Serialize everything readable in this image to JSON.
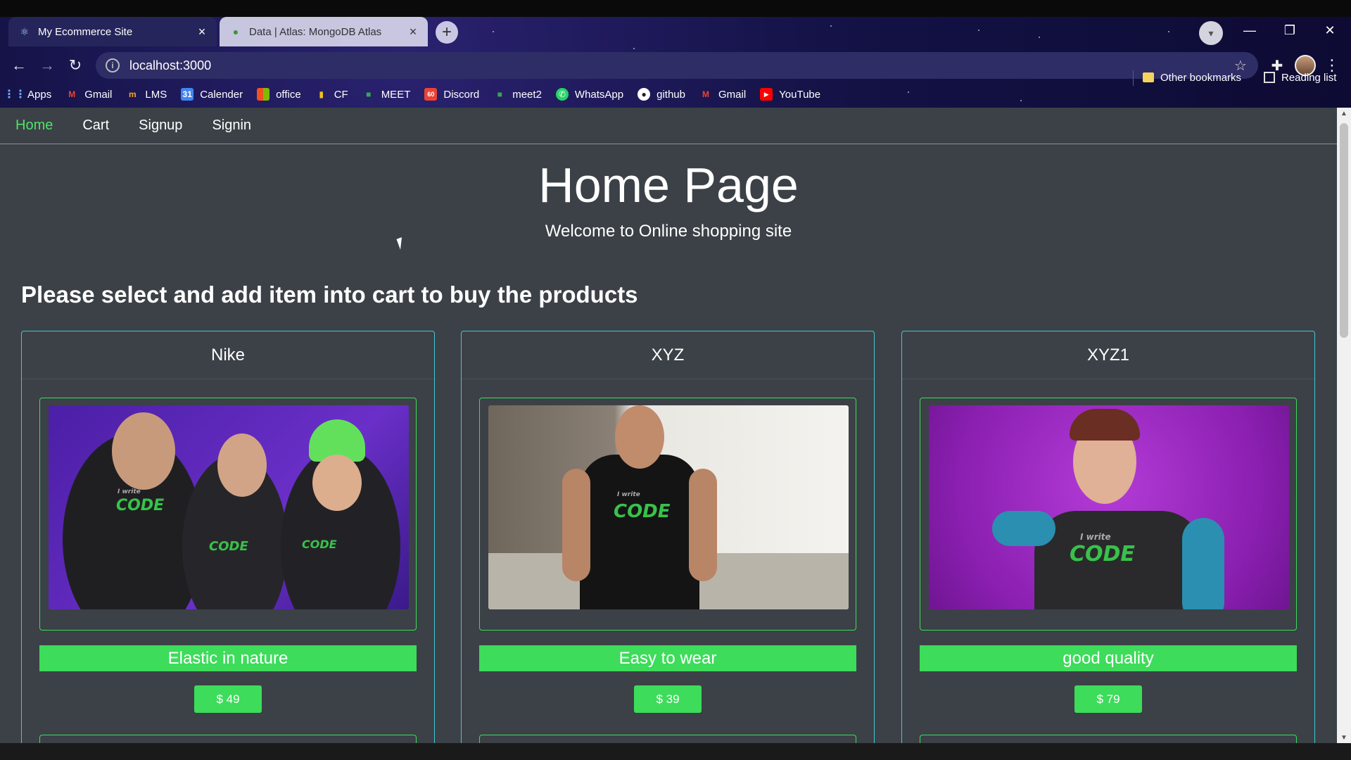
{
  "browser": {
    "tabs": [
      {
        "title": "My Ecommerce Site",
        "active": true
      },
      {
        "title": "Data | Atlas: MongoDB Atlas",
        "active": false
      }
    ],
    "address": "localhost:3000",
    "bookmarks": [
      {
        "label": "Apps",
        "icon": "apps-grid-icon"
      },
      {
        "label": "Gmail",
        "icon": "gmail-icon"
      },
      {
        "label": "LMS",
        "icon": "lms-icon"
      },
      {
        "label": "Calender",
        "icon": "calendar-icon"
      },
      {
        "label": "office",
        "icon": "office-icon"
      },
      {
        "label": "CF",
        "icon": "codeforces-icon"
      },
      {
        "label": "MEET",
        "icon": "meet-icon"
      },
      {
        "label": "Discord",
        "icon": "discord-icon"
      },
      {
        "label": "meet2",
        "icon": "meet-icon"
      },
      {
        "label": "WhatsApp",
        "icon": "whatsapp-icon"
      },
      {
        "label": "github",
        "icon": "github-icon"
      },
      {
        "label": "Gmail",
        "icon": "gmail-icon"
      },
      {
        "label": "YouTube",
        "icon": "youtube-icon"
      }
    ],
    "other_bookmarks": "Other bookmarks",
    "reading_list": "Reading list"
  },
  "site": {
    "nav": [
      {
        "label": "Home",
        "active": true
      },
      {
        "label": "Cart",
        "active": false
      },
      {
        "label": "Signup",
        "active": false
      },
      {
        "label": "Signin",
        "active": false
      }
    ],
    "hero_title": "Home Page",
    "hero_subtitle": "Welcome to Online shopping site",
    "section_title": "Please select and add item into cart to buy the products",
    "products": [
      {
        "name": "Nike",
        "description": "Elastic in nature",
        "price": "$ 49",
        "image": "three people in black I write CODE hoodies"
      },
      {
        "name": "XYZ",
        "description": "Easy to wear",
        "price": "$ 39",
        "image": "man in black I write CODE t-shirt"
      },
      {
        "name": "XYZ1",
        "description": "good quality",
        "price": "$ 79",
        "image": "woman in raglan I write CODE shirt on purple"
      }
    ],
    "image_text_top": "I write",
    "image_text_code": "CODE"
  },
  "colors": {
    "page_bg": "#3b4146",
    "accent_green": "#3ddc5a",
    "nav_active": "#4fe26b",
    "card_border": "#44c8d6"
  }
}
